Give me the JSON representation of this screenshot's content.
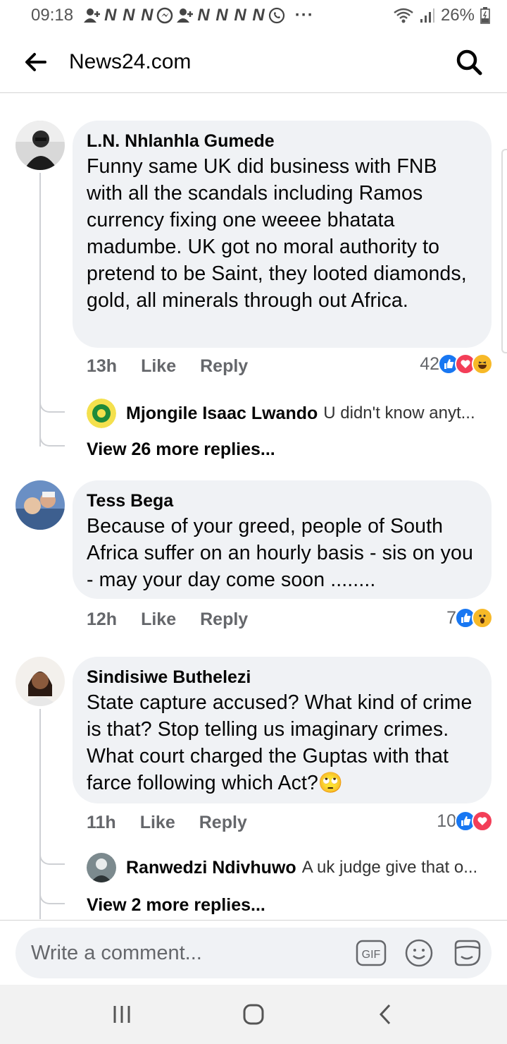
{
  "status_bar": {
    "time": "09:18",
    "notification_glyphs": "N N N",
    "notification_glyphs_2": "N N N N",
    "more": "···",
    "battery": "26%"
  },
  "app_bar": {
    "title": "News24.com"
  },
  "comments": [
    {
      "author": "L.N. Nhlanhla Gumede",
      "text": "Funny same UK did business with FNB with all the scandals including Ramos currency fixing one weeee bhatata madumbe. UK got no moral authority to pretend to be Saint, they looted diamonds, gold, all minerals through out Africa.",
      "time": "13h",
      "like_label": "Like",
      "reply_label": "Reply",
      "reaction_count": "42",
      "reactions": [
        "like",
        "love",
        "haha"
      ],
      "reply_preview": {
        "author": "Mjongile Isaac Lwando",
        "text": "U didn't know anyt..."
      },
      "view_more": "View 26 more replies..."
    },
    {
      "author": "Tess Bega",
      "text": "Because of your greed,  people of South Africa suffer on an hourly basis - sis on you - may your day come soon ........",
      "time": "12h",
      "like_label": "Like",
      "reply_label": "Reply",
      "reaction_count": "7",
      "reactions": [
        "like",
        "wow"
      ]
    },
    {
      "author": "Sindisiwe Buthelezi",
      "text": "State capture accused? What kind of crime is that? Stop telling us imaginary crimes. What court charged the Guptas with that farce following which Act?🙄",
      "time": "11h",
      "like_label": "Like",
      "reply_label": "Reply",
      "reaction_count": "10",
      "reactions": [
        "like",
        "love"
      ],
      "reply_preview": {
        "author": "Ranwedzi Ndivhuwo",
        "text": "A uk judge give that o..."
      },
      "view_more": "View 2 more replies..."
    }
  ],
  "composer": {
    "placeholder": "Write a comment...",
    "gif_label": "GIF"
  },
  "colors": {
    "bubble": "#f0f2f5",
    "meta_text": "#65676b",
    "like_blue": "#1877f2",
    "love_red": "#f33e58",
    "haha_yellow": "#f7b928"
  }
}
